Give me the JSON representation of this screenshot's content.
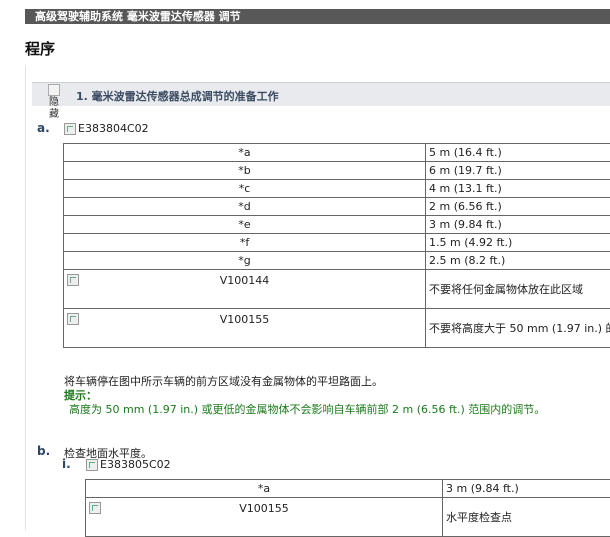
{
  "header": {
    "breadcrumb": "高级驾驶辅助系统 毫米波雷达传感器 调节"
  },
  "page": {
    "title": "程序"
  },
  "section1": {
    "title": "1. 毫米波雷达传感器总成调节的准备工作",
    "hide_label": "隐藏"
  },
  "step_a": {
    "marker": "a.",
    "image_label": "E383804C02",
    "rows": [
      {
        "label": "*a",
        "value": "5 m (16.4 ft.)"
      },
      {
        "label": "*b",
        "value": "6 m (19.7 ft.)"
      },
      {
        "label": "*c",
        "value": "4 m (13.1 ft.)"
      },
      {
        "label": "*d",
        "value": "2 m (6.56 ft.)"
      },
      {
        "label": "*e",
        "value": "3 m (9.84 ft.)"
      },
      {
        "label": "*f",
        "value": "1.5 m (4.92 ft.)"
      },
      {
        "label": "*g",
        "value": "2.5 m (8.2 ft.)"
      }
    ],
    "icon_rows": [
      {
        "code": "V100144",
        "text": "不要将任何金属物体放在此区域"
      },
      {
        "code": "V100155",
        "text": "不要将高度大于 50 mm (1.97 in.) 的物体放在此区域"
      }
    ],
    "instruction": "将车辆停在图中所示车辆的前方区域没有金属物体的平坦路面上。",
    "hint_title": "提示：",
    "hint_text": "高度为 50 mm (1.97 in.) 或更低的金属物体不会影响自车辆前部 2 m (6.56 ft.) 范围内的调节。"
  },
  "step_b": {
    "marker": "b.",
    "text": "检查地面水平度。",
    "sub_marker": "i.",
    "image_label": "E383805C02",
    "rows": [
      {
        "label": "*a",
        "value": "3 m (9.84 ft.)"
      }
    ],
    "icon_rows": [
      {
        "code": "V100155",
        "text": "水平度检查点"
      }
    ]
  }
}
